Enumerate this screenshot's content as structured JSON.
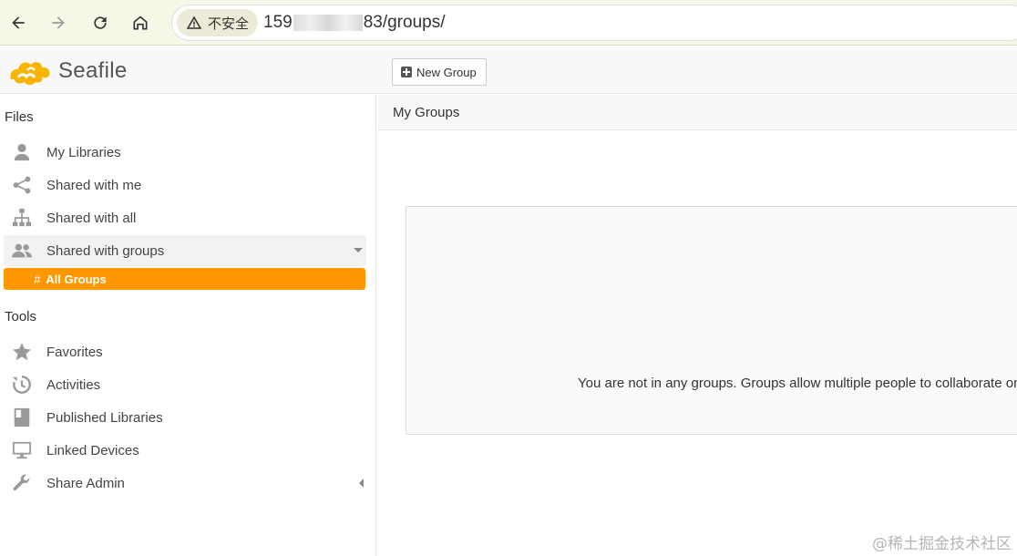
{
  "browser": {
    "security_label": "不安全",
    "url_prefix": "159",
    "url_suffix": "83/groups/"
  },
  "header": {
    "logo_text": "Seafile",
    "new_group_label": "New Group"
  },
  "sidebar": {
    "files_title": "Files",
    "files_items": [
      {
        "label": "My Libraries",
        "icon": "user-icon"
      },
      {
        "label": "Shared with me",
        "icon": "share-nodes-icon"
      },
      {
        "label": "Shared with all",
        "icon": "sitemap-icon"
      },
      {
        "label": "Shared with groups",
        "icon": "users-icon"
      }
    ],
    "active_sub": {
      "hash": "#",
      "label": "All Groups"
    },
    "tools_title": "Tools",
    "tools_items": [
      {
        "label": "Favorites",
        "icon": "star-icon"
      },
      {
        "label": "Activities",
        "icon": "history-icon"
      },
      {
        "label": "Published Libraries",
        "icon": "book-icon"
      },
      {
        "label": "Linked Devices",
        "icon": "monitor-icon"
      },
      {
        "label": "Share Admin",
        "icon": "wrench-icon"
      }
    ]
  },
  "main": {
    "title": "My Groups",
    "empty_message": "You are not in any groups. Groups allow multiple people to collaborate on libraries."
  },
  "watermark": "@稀土掘金技术社区",
  "colors": {
    "accent": "#ff9800",
    "browser_bar": "#f7f7e8",
    "header_bg": "#f8f8f8"
  }
}
